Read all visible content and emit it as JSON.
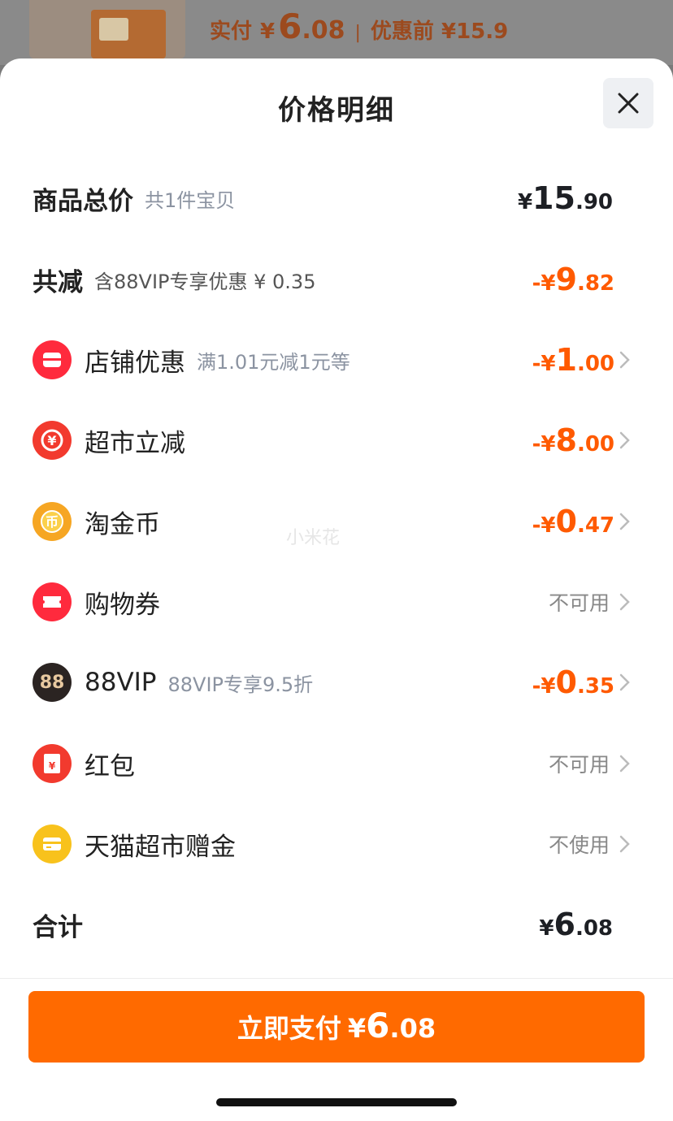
{
  "background": {
    "paid_label": "实付",
    "paid_currency": "¥",
    "paid_int": "6",
    "paid_dec": ".08",
    "separator": "|",
    "original_text": "优惠前 ¥15.9"
  },
  "sheet": {
    "title": "价格明细",
    "close_icon": "close-icon",
    "watermark": "小米花"
  },
  "total": {
    "label": "商品总价",
    "sub": "共1件宝贝",
    "currency": "¥",
    "int": "15",
    "dec": ".90"
  },
  "reduce": {
    "label": "共减",
    "sub": "含88VIP专享优惠 ¥ 0.35",
    "currency": "-¥",
    "int": "9",
    "dec": ".82"
  },
  "items": [
    {
      "label": "店铺优惠",
      "sub": "满1.01元减1元等",
      "currency": "-¥",
      "int": "1",
      "dec": ".00",
      "icon": "shop-icon",
      "color": "#ff2a3d"
    },
    {
      "label": "超市立减",
      "sub": "",
      "currency": "-¥",
      "int": "8",
      "dec": ".00",
      "icon": "discount-icon",
      "color": "#f23a2e"
    },
    {
      "label": "淘金币",
      "sub": "",
      "currency": "-¥",
      "int": "0",
      "dec": ".47",
      "icon": "coin-icon",
      "color": "#f6a623"
    },
    {
      "label": "购物券",
      "sub": "",
      "status": "不可用",
      "icon": "ticket-icon",
      "color": "#ff2a3d"
    },
    {
      "label": "88VIP",
      "sub": "88VIP专享9.5折",
      "currency": "-¥",
      "int": "0",
      "dec": ".35",
      "icon": "vip88-icon",
      "color": "#2b2422",
      "icon_text": "88"
    },
    {
      "label": "红包",
      "sub": "",
      "status": "不可用",
      "icon": "red-envelope-icon",
      "color": "#f23a2e"
    },
    {
      "label": "天猫超市赠金",
      "sub": "",
      "status": "不使用",
      "icon": "gift-card-icon",
      "color": "#f8c21c"
    }
  ],
  "sum": {
    "label": "合计",
    "currency": "¥",
    "int": "6",
    "dec": ".08"
  },
  "pay_button": {
    "label": "立即支付",
    "currency": "¥",
    "int": "6",
    "dec": ".08"
  },
  "colors": {
    "accent": "#ff6a00",
    "discount": "#ff5a00"
  }
}
